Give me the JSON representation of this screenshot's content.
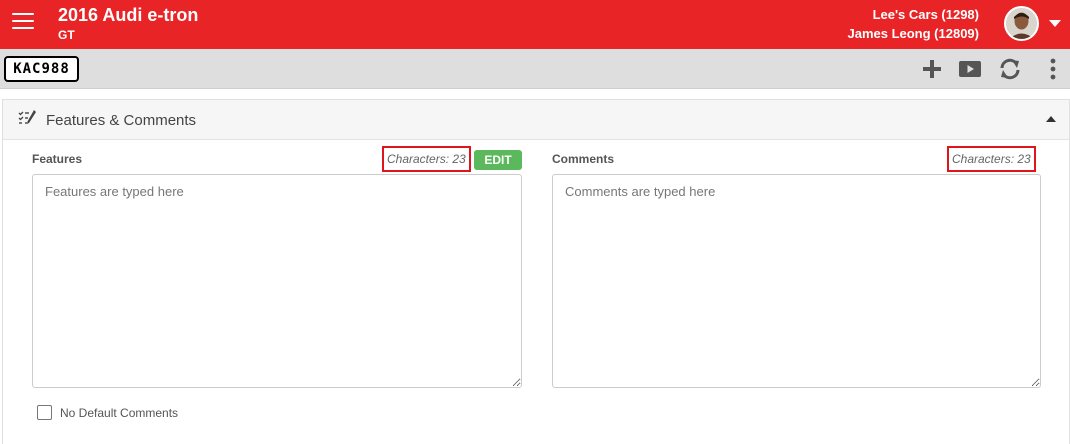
{
  "header": {
    "title": "2016 Audi e-tron",
    "subtitle": "GT",
    "dealer": "Lee's Cars (1298)",
    "user": "James Leong (12809)",
    "menu_icon": "hamburger-menu-icon",
    "account_caret_icon": "caret-down-icon"
  },
  "toolbar": {
    "plate": "KAC988",
    "icons": [
      "plus-icon",
      "video-play-icon",
      "refresh-icon",
      "more-vertical-icon"
    ]
  },
  "panel": {
    "title": "Features & Comments",
    "icon": "list-edit-icon",
    "collapse_icon": "caret-up-icon"
  },
  "features": {
    "label": "Features",
    "char_count": "Characters: 23",
    "edit_label": "EDIT",
    "placeholder": "Features are typed here"
  },
  "comments": {
    "label": "Comments",
    "char_count": "Characters: 23",
    "placeholder": "Comments are typed here"
  },
  "options": {
    "no_default_comments": "No Default Comments"
  },
  "colors": {
    "brand": "#e82427",
    "edit_button": "#5cb85c",
    "highlight": "#e0141b"
  }
}
